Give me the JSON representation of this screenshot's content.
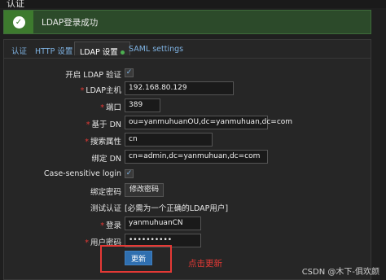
{
  "window": {
    "title": "认证"
  },
  "banner": {
    "message": "LDAP登录成功",
    "icon": "check-circle-icon"
  },
  "tabs": [
    {
      "label": "认证",
      "active": false
    },
    {
      "label": "HTTP 设置",
      "active": false
    },
    {
      "label": "LDAP 设置",
      "active": true
    },
    {
      "label": "SAML settings",
      "active": false
    }
  ],
  "form": {
    "enable_ldap": {
      "label": "开启 LDAP 验证",
      "checked": true
    },
    "host": {
      "label": "LDAP主机",
      "required": true,
      "value": "192.168.80.129"
    },
    "port": {
      "label": "端口",
      "required": true,
      "value": "389"
    },
    "base_dn": {
      "label": "基于 DN",
      "required": true,
      "value": "ou=yanmuhuanOU,dc=yanmuhuan,dc=com"
    },
    "search_attr": {
      "label": "搜索属性",
      "required": true,
      "value": "cn"
    },
    "bind_dn": {
      "label": "绑定 DN",
      "required": false,
      "value": "cn=admin,dc=yanmuhuan,dc=com"
    },
    "case_sensitive": {
      "label": "Case-sensitive login",
      "checked": true
    },
    "bind_password": {
      "label": "绑定密码",
      "button_label": "修改密码"
    },
    "test_auth": {
      "label": "测试认证",
      "note": "[必需为一个正确的LDAP用户]"
    },
    "login": {
      "label": "登录",
      "required": true,
      "value": "yanmuhuanCN"
    },
    "user_password": {
      "label": "用户密码",
      "required": true,
      "value": "••••••••••"
    },
    "update_button": "更新"
  },
  "annotation": "点击更新",
  "watermark": "CSDN @木下-俱欢颜",
  "colors": {
    "success": "#3d7a2e",
    "required": "#e53935",
    "link": "#7fb3e3",
    "primary": "#2f6fb0"
  }
}
